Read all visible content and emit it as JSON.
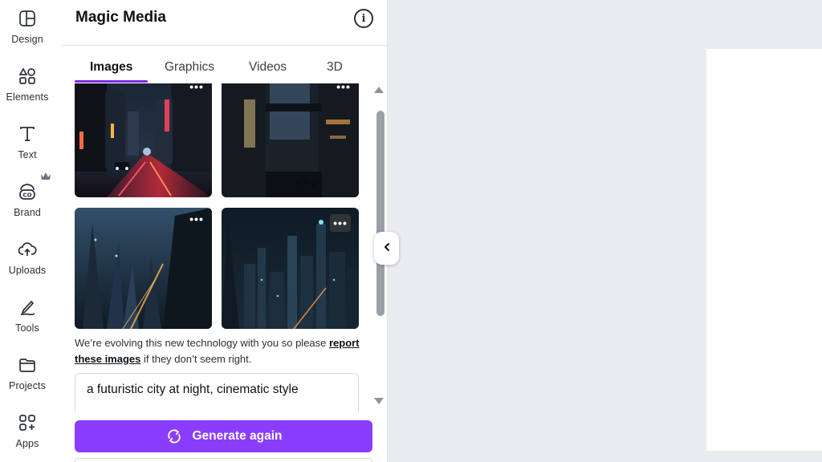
{
  "rail": {
    "items": [
      {
        "label": "Design",
        "icon": "layout-icon"
      },
      {
        "label": "Elements",
        "icon": "shapes-icon"
      },
      {
        "label": "Text",
        "icon": "text-icon"
      },
      {
        "label": "Brand",
        "icon": "brand-icon"
      },
      {
        "label": "Uploads",
        "icon": "cloud-upload-icon"
      },
      {
        "label": "Tools",
        "icon": "pen-tool-icon"
      },
      {
        "label": "Projects",
        "icon": "folder-icon"
      },
      {
        "label": "Apps",
        "icon": "apps-grid-icon"
      }
    ],
    "brand_badge_icon": "crown-icon"
  },
  "panel": {
    "title": "Magic Media",
    "info_icon": "info-icon",
    "tabs": [
      {
        "label": "Images",
        "active": true
      },
      {
        "label": "Graphics",
        "active": false
      },
      {
        "label": "Videos",
        "active": false
      },
      {
        "label": "3D",
        "active": false
      }
    ],
    "more_glyph": "•••",
    "notice_before": "We’re evolving this new technology with you so please ",
    "notice_link": "report these images",
    "notice_after": " if they don’t seem right.",
    "prompt_value": "a futuristic city at night, cinematic style",
    "generate_label": "Generate again",
    "generate_icon": "refresh-icon"
  },
  "colors": {
    "accent": "#8b3dff",
    "tab_underline": "#7d2ae8",
    "canvas_bg": "#ebecf0"
  }
}
